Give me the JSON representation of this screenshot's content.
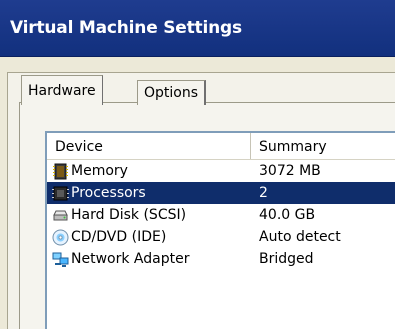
{
  "window": {
    "title": "Virtual Machine Settings"
  },
  "tabs": [
    {
      "label": "Hardware",
      "selected": true
    },
    {
      "label": "Options",
      "selected": false
    }
  ],
  "device_list": {
    "columns": {
      "device": "Device",
      "summary": "Summary"
    },
    "rows": [
      {
        "icon": "memory-icon",
        "device": "Memory",
        "summary": "3072 MB",
        "selected": false
      },
      {
        "icon": "processor-icon",
        "device": "Processors",
        "summary": "2",
        "selected": true
      },
      {
        "icon": "hard-disk-icon",
        "device": "Hard Disk (SCSI)",
        "summary": "40.0 GB",
        "selected": false
      },
      {
        "icon": "cd-dvd-icon",
        "device": "CD/DVD (IDE)",
        "summary": "Auto detect",
        "selected": false
      },
      {
        "icon": "network-adapter-icon",
        "device": "Network Adapter",
        "summary": "Bridged",
        "selected": false
      }
    ]
  },
  "colors": {
    "titlebar": "#12307e",
    "selection": "#0f2d6b"
  }
}
